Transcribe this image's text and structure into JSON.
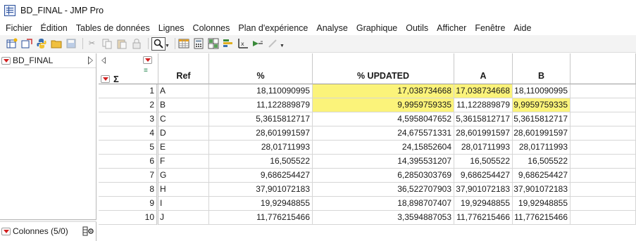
{
  "window": {
    "title": "BD_FINAL - JMP Pro"
  },
  "menu": [
    "Fichier",
    "Édition",
    "Tables de données",
    "Lignes",
    "Colonnes",
    "Plan d'expérience",
    "Analyse",
    "Graphique",
    "Outils",
    "Afficher",
    "Fenêtre",
    "Aide"
  ],
  "toolbar": {
    "icons": [
      "new-table-icon",
      "open-icon",
      "python-icon",
      "folder-icon",
      "save-icon",
      "cut-icon",
      "copy-icon",
      "paste-icon",
      "lock-icon",
      "search-icon",
      "data-grid-icon",
      "calculator-icon",
      "tabulate-icon",
      "distribution-icon",
      "graph-builder-icon",
      "fit-model-icon",
      "script-icon"
    ]
  },
  "left_panel": {
    "table_name": "BD_FINAL",
    "columns_label": "Colonnes (5/0)"
  },
  "table": {
    "columns": [
      "Ref",
      "%",
      "% UPDATED",
      "A",
      "B"
    ],
    "rows": [
      {
        "n": "1",
        "ref": "A",
        "pct": "18,110090995",
        "upd": "17,038734668",
        "a": "17,038734668",
        "b": "18,110090995"
      },
      {
        "n": "2",
        "ref": "B",
        "pct": "11,122889879",
        "upd": "9,9959759335",
        "a": "11,122889879",
        "b": "9,9959759335"
      },
      {
        "n": "3",
        "ref": "C",
        "pct": "5,3615812717",
        "upd": "4,5958047652",
        "a": "5,3615812717",
        "b": "5,3615812717"
      },
      {
        "n": "4",
        "ref": "D",
        "pct": "28,601991597",
        "upd": "24,675571331",
        "a": "28,601991597",
        "b": "28,601991597"
      },
      {
        "n": "5",
        "ref": "E",
        "pct": "28,01711993",
        "upd": "24,15852604",
        "a": "28,01711993",
        "b": "28,01711993"
      },
      {
        "n": "6",
        "ref": "F",
        "pct": "16,505522",
        "upd": "14,395531207",
        "a": "16,505522",
        "b": "16,505522"
      },
      {
        "n": "7",
        "ref": "G",
        "pct": "9,686254427",
        "upd": "6,2850303769",
        "a": "9,686254427",
        "b": "9,686254427"
      },
      {
        "n": "8",
        "ref": "H",
        "pct": "37,901072183",
        "upd": "36,522707903",
        "a": "37,901072183",
        "b": "37,901072183"
      },
      {
        "n": "9",
        "ref": "I",
        "pct": "19,92948855",
        "upd": "18,898707407",
        "a": "19,92948855",
        "b": "19,92948855"
      },
      {
        "n": "10",
        "ref": "J",
        "pct": "11,776215466",
        "upd": "3,3594887053",
        "a": "11,776215466",
        "b": "11,776215466"
      }
    ],
    "highlight": {
      "color": "#fbf37a",
      "cells": [
        "1.upd",
        "1.a",
        "2.upd",
        "2.b"
      ]
    }
  }
}
